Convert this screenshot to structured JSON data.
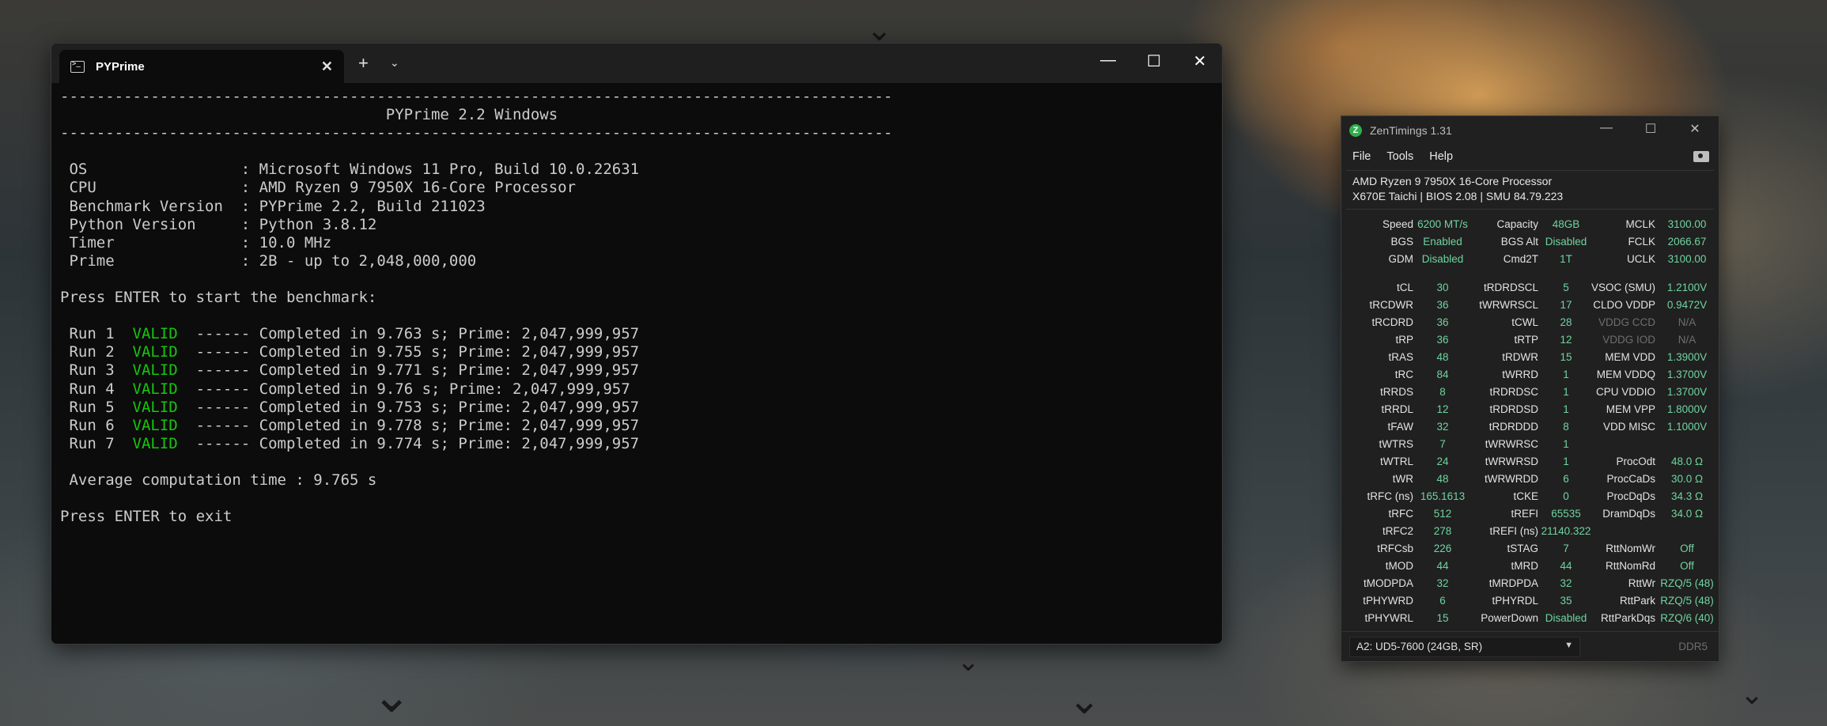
{
  "terminal": {
    "tab_title": "PYPrime",
    "new_tab_glyph": "+",
    "lines": [
      {
        "text": "--------------------------------------------------------------------------------------------"
      },
      {
        "text": "                                    PYPrime 2.2 Windows"
      },
      {
        "text": "--------------------------------------------------------------------------------------------"
      },
      {
        "text": ""
      },
      {
        "text": " OS                 : Microsoft Windows 11 Pro, Build 10.0.22631"
      },
      {
        "text": " CPU                : AMD Ryzen 9 7950X 16-Core Processor"
      },
      {
        "text": " Benchmark Version  : PYPrime 2.2, Build 211023"
      },
      {
        "text": " Python Version     : Python 3.8.12"
      },
      {
        "text": " Timer              : 10.0 MHz"
      },
      {
        "text": " Prime              : 2B - up to 2,048,000,000"
      },
      {
        "text": ""
      },
      {
        "text": "Press ENTER to start the benchmark:"
      },
      {
        "text": ""
      },
      {
        "pre": " Run 1  ",
        "status": "VALID",
        "post": "  ------ Completed in 9.763 s; Prime: 2,047,999,957"
      },
      {
        "pre": " Run 2  ",
        "status": "VALID",
        "post": "  ------ Completed in 9.755 s; Prime: 2,047,999,957"
      },
      {
        "pre": " Run 3  ",
        "status": "VALID",
        "post": "  ------ Completed in 9.771 s; Prime: 2,047,999,957"
      },
      {
        "pre": " Run 4  ",
        "status": "VALID",
        "post": "  ------ Completed in 9.76 s; Prime: 2,047,999,957"
      },
      {
        "pre": " Run 5  ",
        "status": "VALID",
        "post": "  ------ Completed in 9.753 s; Prime: 2,047,999,957"
      },
      {
        "pre": " Run 6  ",
        "status": "VALID",
        "post": "  ------ Completed in 9.778 s; Prime: 2,047,999,957"
      },
      {
        "pre": " Run 7  ",
        "status": "VALID",
        "post": "  ------ Completed in 9.774 s; Prime: 2,047,999,957"
      },
      {
        "text": ""
      },
      {
        "text": " Average computation time : 9.765 s"
      },
      {
        "text": ""
      },
      {
        "text": "Press ENTER to exit"
      }
    ],
    "valid_color": "#16c60c"
  },
  "zen": {
    "title": "ZenTimings 1.31",
    "menu": {
      "file": "File",
      "tools": "Tools",
      "help": "Help"
    },
    "cpu": "AMD Ryzen 9 7950X 16-Core Processor",
    "board": "X670E Taichi | BIOS 2.08 | SMU 84.79.223",
    "rows": [
      [
        [
          "Speed",
          "6200 MT/s"
        ],
        [
          "Capacity",
          "48GB"
        ],
        [
          "MCLK",
          "3100.00"
        ]
      ],
      [
        [
          "BGS",
          "Enabled"
        ],
        [
          "BGS Alt",
          "Disabled"
        ],
        [
          "FCLK",
          "2066.67"
        ]
      ],
      [
        [
          "GDM",
          "Disabled"
        ],
        [
          "Cmd2T",
          "1T"
        ],
        [
          "UCLK",
          "3100.00"
        ]
      ],
      "gap",
      [
        [
          "tCL",
          "30"
        ],
        [
          "tRDRDSCL",
          "5"
        ],
        [
          "VSOC (SMU)",
          "1.2100V"
        ]
      ],
      [
        [
          "tRCDWR",
          "36"
        ],
        [
          "tWRWRSCL",
          "17"
        ],
        [
          "CLDO VDDP",
          "0.9472V"
        ]
      ],
      [
        [
          "tRCDRD",
          "36"
        ],
        [
          "tCWL",
          "28"
        ],
        [
          "VDDG CCD",
          "N/A",
          "dim"
        ]
      ],
      [
        [
          "tRP",
          "36"
        ],
        [
          "tRTP",
          "12"
        ],
        [
          "VDDG IOD",
          "N/A",
          "dim"
        ]
      ],
      [
        [
          "tRAS",
          "48"
        ],
        [
          "tRDWR",
          "15"
        ],
        [
          "MEM VDD",
          "1.3900V"
        ]
      ],
      [
        [
          "tRC",
          "84"
        ],
        [
          "tWRRD",
          "1"
        ],
        [
          "MEM VDDQ",
          "1.3700V"
        ]
      ],
      [
        [
          "tRRDS",
          "8"
        ],
        [
          "tRDRDSC",
          "1"
        ],
        [
          "CPU VDDIO",
          "1.3700V"
        ]
      ],
      [
        [
          "tRRDL",
          "12"
        ],
        [
          "tRDRDSD",
          "1"
        ],
        [
          "MEM VPP",
          "1.8000V"
        ]
      ],
      [
        [
          "tFAW",
          "32"
        ],
        [
          "tRDRDDD",
          "8"
        ],
        [
          "VDD MISC",
          "1.1000V"
        ]
      ],
      [
        [
          "tWTRS",
          "7"
        ],
        [
          "tWRWRSC",
          "1"
        ],
        null
      ],
      [
        [
          "tWTRL",
          "24"
        ],
        [
          "tWRWRSD",
          "1"
        ],
        [
          "ProcOdt",
          "48.0 Ω"
        ]
      ],
      [
        [
          "tWR",
          "48"
        ],
        [
          "tWRWRDD",
          "6"
        ],
        [
          "ProcCaDs",
          "30.0 Ω"
        ]
      ],
      [
        [
          "tRFC (ns)",
          "165.1613"
        ],
        [
          "tCKE",
          "0"
        ],
        [
          "ProcDqDs",
          "34.3 Ω"
        ]
      ],
      [
        [
          "tRFC",
          "512"
        ],
        [
          "tREFI",
          "65535"
        ],
        [
          "DramDqDs",
          "34.0 Ω"
        ]
      ],
      [
        [
          "tRFC2",
          "278"
        ],
        [
          "tREFI (ns)",
          "21140.322"
        ],
        null
      ],
      [
        [
          "tRFCsb",
          "226"
        ],
        [
          "tSTAG",
          "7"
        ],
        [
          "RttNomWr",
          "Off"
        ]
      ],
      [
        [
          "tMOD",
          "44"
        ],
        [
          "tMRD",
          "44"
        ],
        [
          "RttNomRd",
          "Off"
        ]
      ],
      [
        [
          "tMODPDA",
          "32"
        ],
        [
          "tMRDPDA",
          "32"
        ],
        [
          "RttWr",
          "RZQ/5 (48)"
        ]
      ],
      [
        [
          "tPHYWRD",
          "6"
        ],
        [
          "tPHYRDL",
          "35"
        ],
        [
          "RttPark",
          "RZQ/5 (48)"
        ]
      ],
      [
        [
          "tPHYWRL",
          "15"
        ],
        [
          "PowerDown",
          "Disabled"
        ],
        [
          "RttParkDqs",
          "RZQ/6 (40)"
        ]
      ]
    ],
    "dimm": "A2: UD5-7600 (24GB, SR)",
    "ddr": "DDR5",
    "value_color": "#6fd3a0"
  }
}
